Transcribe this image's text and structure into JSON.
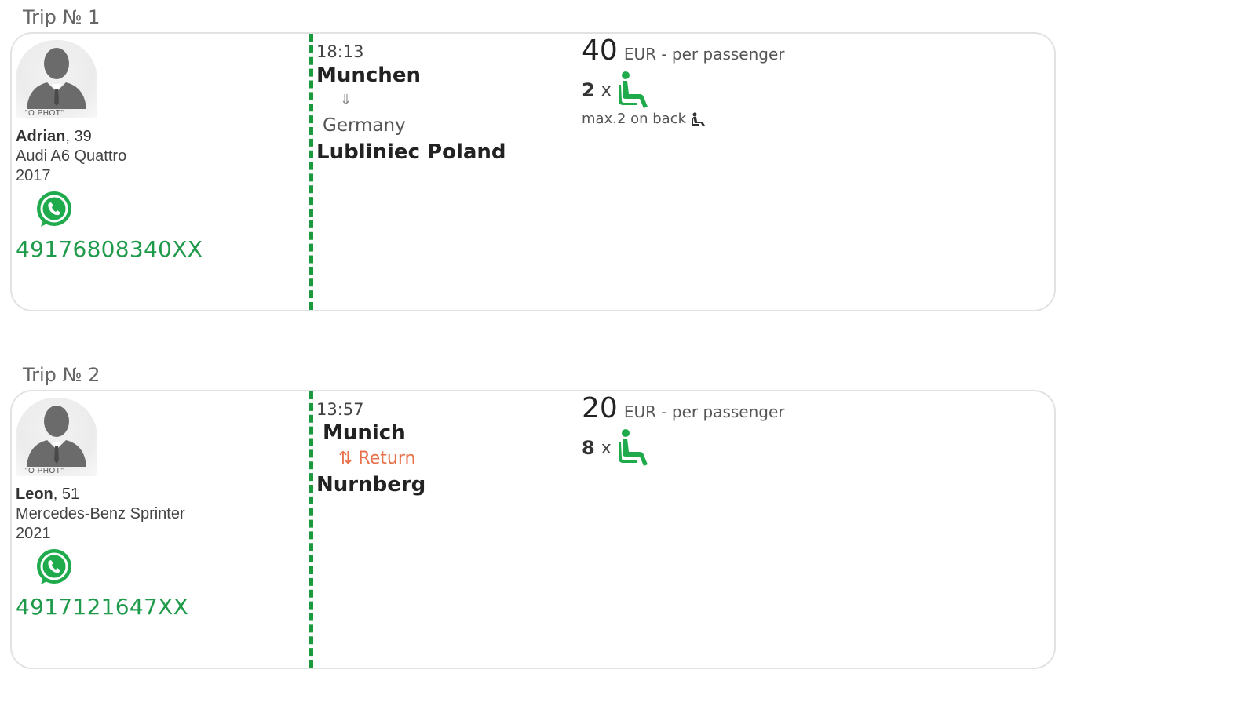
{
  "colors": {
    "accent_green": "#1e9a4a",
    "return_orange": "#e8704a",
    "divider_green": "#1a9a3c"
  },
  "trips": [
    {
      "title": "Trip № 1",
      "driver": {
        "photo_caption": "\"O PHOT\"",
        "name": "Adrian",
        "age_suffix": ", 39",
        "car": "Audi A6 Quattro",
        "year": "2017",
        "contact_icon": "whatsapp-icon",
        "phone": "49176808340XX"
      },
      "route": {
        "time": "18:13",
        "from": "Munchen",
        "arrow": "⇓",
        "country": "Germany",
        "to": "Lubliniec Poland"
      },
      "price": {
        "amount": "40",
        "unit": "EUR - per passenger",
        "seats": "2",
        "times": "x",
        "seat_icon": "seat-icon",
        "note": "max.2 on back"
      }
    },
    {
      "title": "Trip № 2",
      "driver": {
        "photo_caption": "\"O PHOT\"",
        "name": "Leon",
        "age_suffix": ", 51",
        "car": "Mercedes-Benz Sprinter",
        "year": "2021",
        "contact_icon": "whatsapp-icon",
        "phone": "4917121647XX"
      },
      "route": {
        "time": "13:57",
        "from": "Munich",
        "return_label": "⇅ Return",
        "to": "Nurnberg"
      },
      "price": {
        "amount": "20",
        "unit": "EUR - per passenger",
        "seats": "8",
        "times": "x",
        "seat_icon": "seat-icon"
      }
    }
  ]
}
